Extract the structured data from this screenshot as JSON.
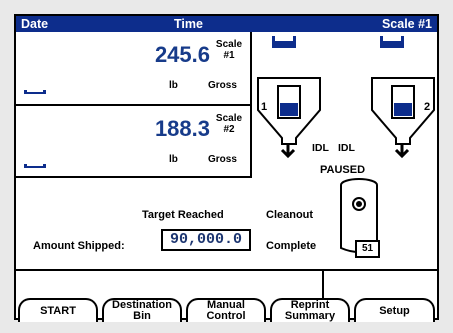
{
  "header": {
    "date_label": "Date",
    "time_label": "Time",
    "scale_label": "Scale #1"
  },
  "scales": [
    {
      "weight": "245.6",
      "scale_line1": "Scale",
      "scale_line2": "#1",
      "unit": "lb",
      "mode": "Gross"
    },
    {
      "weight": "188.3",
      "scale_line1": "Scale",
      "scale_line2": "#2",
      "unit": "lb",
      "mode": "Gross"
    }
  ],
  "bins": [
    {
      "number": "1",
      "status": "IDL"
    },
    {
      "number": "2",
      "status": "IDL"
    }
  ],
  "state": "PAUSED",
  "target_status": "Target Reached",
  "amount_shipped": {
    "label": "Amount Shipped:",
    "value": "90,000.0"
  },
  "cleanout": {
    "line1": "Cleanout",
    "line2": "Complete"
  },
  "container_count": "51",
  "tabs": [
    {
      "line1": "START",
      "line2": ""
    },
    {
      "line1": "Destination",
      "line2": "Bin"
    },
    {
      "line1": "Manual",
      "line2": "Control"
    },
    {
      "line1": "Reprint",
      "line2": "Summary"
    },
    {
      "line1": "Setup",
      "line2": ""
    }
  ],
  "colors": {
    "header_bg": "#0d2d8c",
    "weight_text": "#173b8a"
  }
}
